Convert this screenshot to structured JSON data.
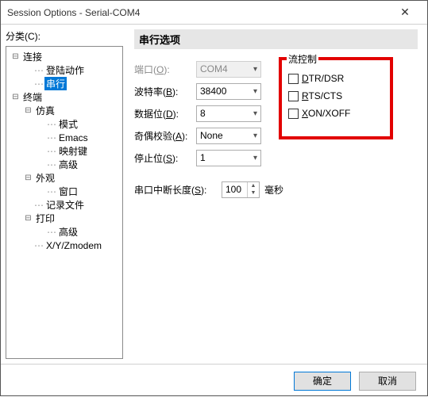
{
  "window": {
    "title": "Session Options - Serial-COM4"
  },
  "left": {
    "category_label": "分类(C):",
    "tree": [
      {
        "indent": 0,
        "expander": "⊟",
        "label": "连接"
      },
      {
        "indent": 1,
        "expander": "",
        "dots": true,
        "label": "登陆动作"
      },
      {
        "indent": 1,
        "expander": "",
        "dots": true,
        "label": "串行",
        "selected": true
      },
      {
        "indent": 0,
        "expander": "⊟",
        "label": "终端"
      },
      {
        "indent": 1,
        "expander": "⊟",
        "label": "仿真"
      },
      {
        "indent": 2,
        "expander": "",
        "dots": true,
        "label": "模式"
      },
      {
        "indent": 2,
        "expander": "",
        "dots": true,
        "label": "Emacs"
      },
      {
        "indent": 2,
        "expander": "",
        "dots": true,
        "label": "映射键"
      },
      {
        "indent": 2,
        "expander": "",
        "dots": true,
        "label": "高级"
      },
      {
        "indent": 1,
        "expander": "⊟",
        "label": "外观"
      },
      {
        "indent": 2,
        "expander": "",
        "dots": true,
        "label": "窗口"
      },
      {
        "indent": 1,
        "expander": "",
        "dots": true,
        "label": "记录文件"
      },
      {
        "indent": 1,
        "expander": "⊟",
        "label": "打印"
      },
      {
        "indent": 2,
        "expander": "",
        "dots": true,
        "label": "高级"
      },
      {
        "indent": 1,
        "expander": "",
        "dots": true,
        "label": "X/Y/Zmodem"
      }
    ]
  },
  "right": {
    "section_title": "串行选项",
    "rows": {
      "port": {
        "label_pre": "端口(",
        "hotkey": "O",
        "label_post": "):",
        "value": "COM4",
        "disabled": true
      },
      "baud": {
        "label_pre": "波特率(",
        "hotkey": "B",
        "label_post": "):",
        "value": "38400"
      },
      "databits": {
        "label_pre": "数据位(",
        "hotkey": "D",
        "label_post": "):",
        "value": "8"
      },
      "parity": {
        "label_pre": "奇偶校验(",
        "hotkey": "A",
        "label_post": "):",
        "value": "None"
      },
      "stopbits": {
        "label_pre": "停止位(",
        "hotkey": "S",
        "label_post": "):",
        "value": "1"
      },
      "break": {
        "label_pre": "串口中断长度(",
        "hotkey": "S",
        "label_post": "):",
        "value": "100",
        "unit": "毫秒"
      }
    },
    "flow": {
      "legend": "流控制",
      "items": [
        {
          "label_hot": "D",
          "label_rest": "TR/DSR"
        },
        {
          "label_hot": "R",
          "label_rest": "TS/CTS"
        },
        {
          "label_hot": "X",
          "label_rest": "ON/XOFF"
        }
      ]
    }
  },
  "footer": {
    "ok": "确定",
    "cancel": "取消"
  }
}
